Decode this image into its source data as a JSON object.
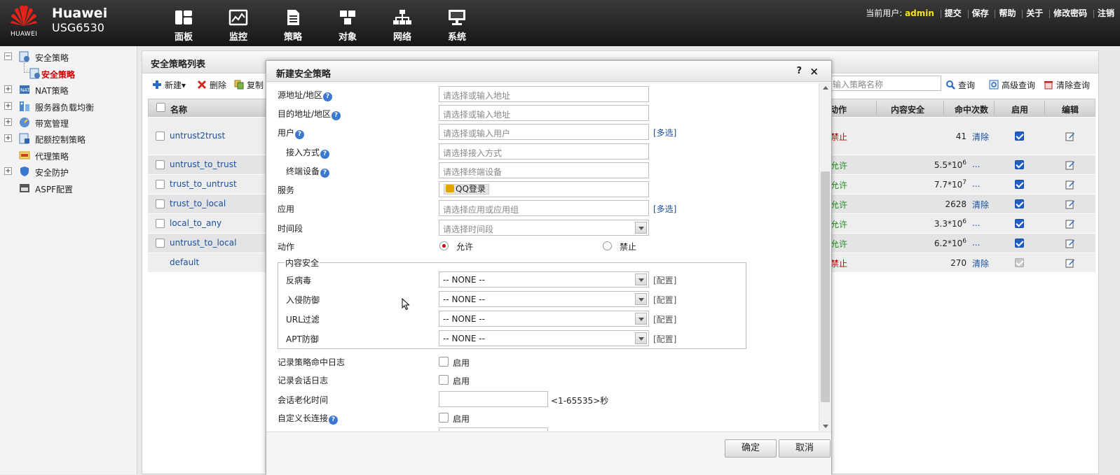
{
  "header": {
    "logo_word": "HUAWEI",
    "brand_line1": "Huawei",
    "brand_line2": "USG6530",
    "nav": [
      {
        "label": "面板",
        "icon": "dashboard-icon"
      },
      {
        "label": "监控",
        "icon": "monitor-chart-icon"
      },
      {
        "label": "策略",
        "icon": "policy-document-icon"
      },
      {
        "label": "对象",
        "icon": "object-icon"
      },
      {
        "label": "网络",
        "icon": "network-icon"
      },
      {
        "label": "系统",
        "icon": "system-computer-icon"
      }
    ],
    "current_user_label": "当前用户:",
    "current_user": "admin",
    "links": [
      "提交",
      "保存",
      "帮助",
      "关于",
      "修改密码",
      "注销"
    ]
  },
  "sidebar": {
    "items": [
      {
        "label": "安全策略",
        "expand": "−"
      },
      {
        "label": "安全策略"
      },
      {
        "label": "NAT策略",
        "expand": "+"
      },
      {
        "label": "服务器负载均衡",
        "expand": "+"
      },
      {
        "label": "带宽管理",
        "expand": "+"
      },
      {
        "label": "配额控制策略",
        "expand": "+"
      },
      {
        "label": "代理策略"
      },
      {
        "label": "安全防护",
        "expand": "+"
      },
      {
        "label": "ASPF配置"
      }
    ]
  },
  "main": {
    "title": "安全策略列表",
    "toolbar": {
      "new": "新建▾",
      "delete": "删除",
      "copy": "复制",
      "search_placeholder": "输入策略名称",
      "query": "查询",
      "advanced": "高级查询",
      "clear": "清除查询"
    },
    "columns": {
      "name": "名称",
      "action": "动作",
      "content": "内容安全",
      "hits": "命中次数",
      "enable": "启用",
      "edit": "编辑"
    },
    "rows": [
      {
        "name": "untrust2trust",
        "action": "禁止",
        "hits": "41",
        "hits_exp": "",
        "clear": "清除",
        "enabled": true
      },
      {
        "name": "untrust_to_trust",
        "action": "允许",
        "hits": "5.5*10",
        "hits_exp": "6",
        "clear": "...",
        "enabled": true
      },
      {
        "name": "trust_to_untrust",
        "action": "允许",
        "hits": "7.7*10",
        "hits_exp": "7",
        "clear": "...",
        "enabled": true
      },
      {
        "name": "trust_to_local",
        "action": "允许",
        "hits": "2628",
        "hits_exp": "",
        "clear": "清除",
        "enabled": true
      },
      {
        "name": "local_to_any",
        "action": "允许",
        "hits": "3.3*10",
        "hits_exp": "6",
        "clear": "...",
        "enabled": true
      },
      {
        "name": "untrust_to_local",
        "action": "允许",
        "hits": "6.2*10",
        "hits_exp": "6",
        "clear": "...",
        "enabled": true
      },
      {
        "name": "default",
        "action": "禁止",
        "hits": "270",
        "hits_exp": "",
        "clear": "清除",
        "enabled": true
      }
    ]
  },
  "modal": {
    "title": "新建安全策略",
    "help": "?",
    "close": "×",
    "fields": {
      "src_addr": {
        "label": "源地址/地区",
        "placeholder": "请选择或输入地址"
      },
      "dst_addr": {
        "label": "目的地址/地区",
        "placeholder": "请选择或输入地址"
      },
      "user": {
        "label": "用户",
        "placeholder": "请选择或输入用户",
        "multi": "[多选]"
      },
      "access": {
        "label": "接入方式",
        "placeholder": "请选择接入方式"
      },
      "terminal": {
        "label": "终端设备",
        "placeholder": "请选择终端设备"
      },
      "service": {
        "label": "服务",
        "tag": "QQ登录"
      },
      "app": {
        "label": "应用",
        "placeholder": "请选择应用或应用组",
        "multi": "[多选]"
      },
      "time": {
        "label": "时间段",
        "placeholder": "请选择时间段"
      },
      "action": {
        "label": "动作",
        "allow": "允许",
        "deny": "禁止"
      }
    },
    "content_security": {
      "legend": "内容安全",
      "items": [
        {
          "label": "反病毒",
          "value": "-- NONE --",
          "config": "[配置]"
        },
        {
          "label": "入侵防御",
          "value": "-- NONE --",
          "config": "[配置]"
        },
        {
          "label": "URL过滤",
          "value": "-- NONE --",
          "config": "[配置]"
        },
        {
          "label": "APT防御",
          "value": "-- NONE --",
          "config": "[配置]"
        }
      ]
    },
    "log_policy": {
      "label": "记录策略命中日志",
      "check": "启用"
    },
    "log_session": {
      "label": "记录会话日志",
      "check": "启用"
    },
    "aging": {
      "label": "会话老化时间",
      "value": "",
      "hint": "<1-65535>秒"
    },
    "long_conn": {
      "label": "自定义长连接",
      "check": "启用"
    },
    "ok": "确定",
    "cancel": "取消"
  },
  "colors": {
    "accent_link": "#1a4fa0",
    "deny": "#c00000",
    "allow": "#1f8a1f",
    "user_highlight": "#f4e41a"
  }
}
